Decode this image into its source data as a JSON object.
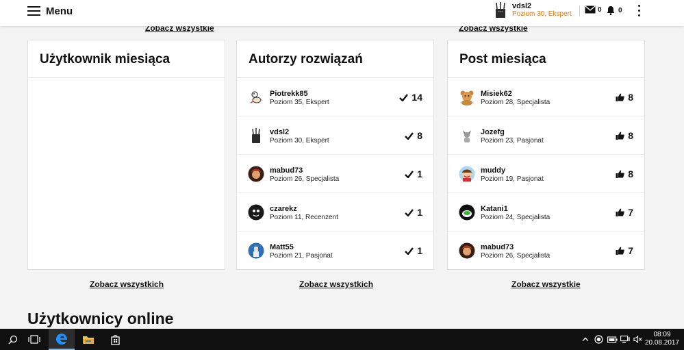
{
  "header": {
    "menu_label": "Menu",
    "user_name": "vdsl2",
    "user_level": "Poziom 30, Ekspert",
    "mail_count": "0",
    "notif_count": "0"
  },
  "clipped_links": {
    "left": "Zobacz wszystkie",
    "right": "Zobacz wszystkie"
  },
  "user_of_month": {
    "title": "Użytkownik miesiąca",
    "see_all": "Zobacz wszystkich"
  },
  "solution_authors": {
    "title": "Autorzy rozwiązań",
    "see_all": "Zobacz wszystkich",
    "items": [
      {
        "name": "Piotrekk85",
        "level": "Poziom 35, Ekspert",
        "count": "14",
        "avatar": "cartoon-avatar"
      },
      {
        "name": "vdsl2",
        "level": "Poziom 30, Ekspert",
        "count": "8",
        "avatar": "router-avatar"
      },
      {
        "name": "mabud73",
        "level": "Poziom 26, Specjalista",
        "count": "1",
        "avatar": "red-hair-avatar"
      },
      {
        "name": "czarekz",
        "level": "Poziom 11, Recenzent",
        "count": "1",
        "avatar": "dark-face-avatar"
      },
      {
        "name": "Matt55",
        "level": "Poziom 21, Pasjonat",
        "count": "1",
        "avatar": "blue-figure-avatar"
      }
    ]
  },
  "post_of_month": {
    "title": "Post miesiąca",
    "see_all": "Zobacz wszystkie",
    "items": [
      {
        "name": "Misiek62",
        "level": "Poziom 28, Specjalista",
        "count": "8",
        "avatar": "teddy-avatar"
      },
      {
        "name": "Jozefg",
        "level": "Poziom 23, Pasjonat",
        "count": "8",
        "avatar": "gray-figure-avatar"
      },
      {
        "name": "muddy",
        "level": "Poziom 19, Pasjonat",
        "count": "8",
        "avatar": "cartoon-face-avatar"
      },
      {
        "name": "Katani1",
        "level": "Poziom 24, Specjalista",
        "count": "7",
        "avatar": "green-cup-avatar"
      },
      {
        "name": "mabud73",
        "level": "Poziom 26, Specjalista",
        "count": "7",
        "avatar": "red-hair-avatar"
      }
    ]
  },
  "online_title": "Użytkownicy online",
  "taskbar": {
    "time": "08:09",
    "date": "20.08.2017"
  },
  "colors": {
    "accent_orange": "#e8730c",
    "edge_blue": "#1e90ff",
    "taskbar": "#101010"
  }
}
